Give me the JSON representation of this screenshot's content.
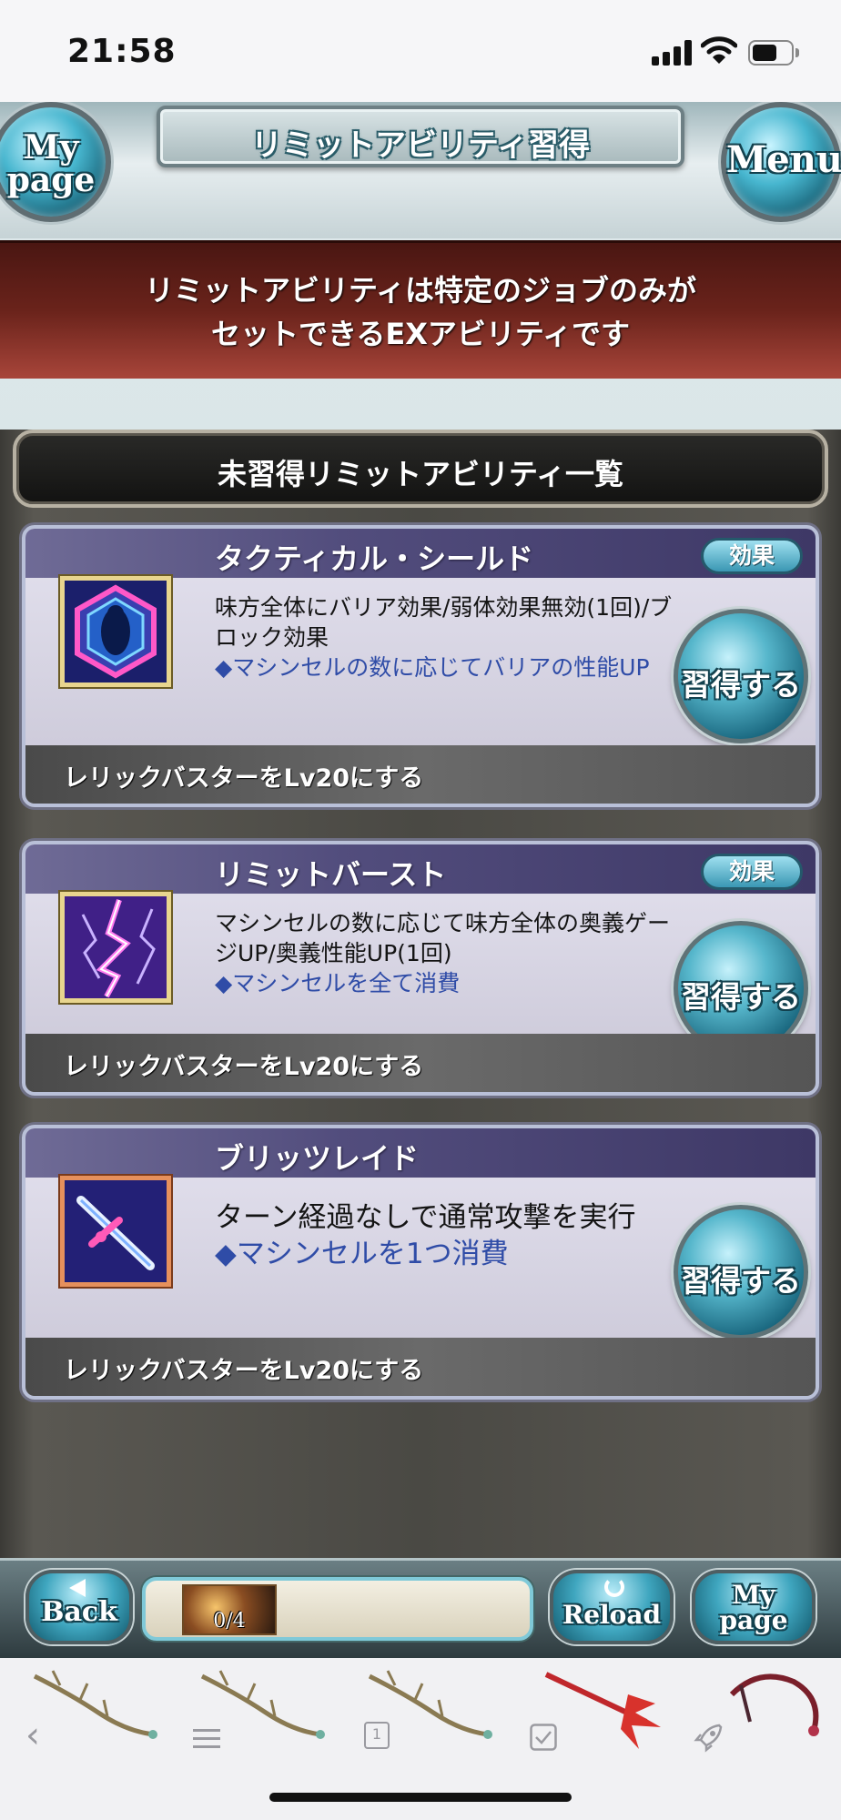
{
  "status_bar": {
    "time": "21:58"
  },
  "header": {
    "title": "リミットアビリティ習得",
    "mypage_label": "My page",
    "menu_label": "Menu"
  },
  "info": {
    "line1": "リミットアビリティは特定のジョブのみが",
    "line2": "セットできるEXアビリティです"
  },
  "section": {
    "title": "未習得リミットアビリティ一覧"
  },
  "abilities": [
    {
      "name": "タクティカル・シールド",
      "effect_label": "効果",
      "description": "味方全体にバリア効果/弱体効果無効(1回)/ブロック効果",
      "highlight": "◆マシンセルの数に応じてバリアの性能UP",
      "learn_label": "習得する",
      "requirement": "レリックバスターをLv20にする",
      "icon": "shield-icon"
    },
    {
      "name": "リミットバースト",
      "effect_label": "効果",
      "description": "マシンセルの数に応じて味方全体の奥義ゲージUP/奥義性能UP(1回)",
      "highlight": "◆マシンセルを全て消費",
      "learn_label": "習得する",
      "requirement": "レリックバスターをLv20にする",
      "icon": "lightning-icon"
    },
    {
      "name": "ブリッツレイド",
      "description": "ターン経過なしで通常攻撃を実行",
      "highlight": "◆マシンセルを1つ消費",
      "learn_label": "習得する",
      "requirement": "レリックバスターをLv20にする",
      "icon": "sword-icon"
    }
  ],
  "bottom_nav": {
    "back_label": "Back",
    "progress_text": "0/4",
    "progress_fraction": 0,
    "reload_label": "Reload",
    "mypage_label": "My page"
  },
  "toolbar": {
    "items": [
      {
        "icon": "back-chevron-icon"
      },
      {
        "icon": "list-icon"
      },
      {
        "icon": "tab-count-icon",
        "count": "1"
      },
      {
        "icon": "checkbox-icon"
      },
      {
        "icon": "rocket-icon"
      }
    ]
  },
  "colors": {
    "info_banner": "#6a231b",
    "card_header": "#524d7d",
    "highlight_text": "#2f4ca7",
    "button_cyan": "#3fa6bf"
  }
}
